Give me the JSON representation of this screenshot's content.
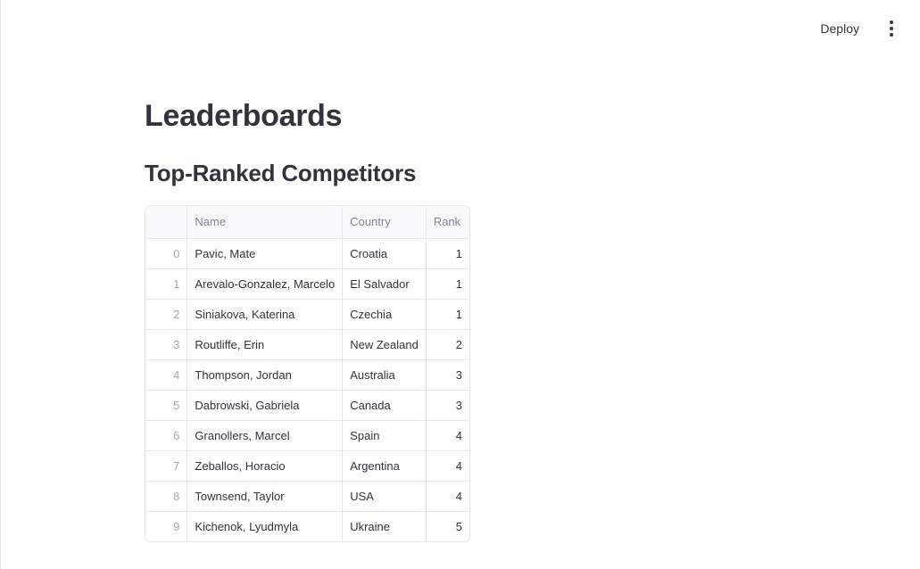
{
  "header": {
    "deploy_label": "Deploy"
  },
  "main": {
    "title": "Leaderboards",
    "subtitle": "Top-Ranked Competitors"
  },
  "table": {
    "columns": [
      "",
      "Name",
      "Country",
      "Rank"
    ],
    "rows": [
      {
        "index": "0",
        "name": "Pavic, Mate",
        "country": "Croatia",
        "rank": "1"
      },
      {
        "index": "1",
        "name": "Arevalo-Gonzalez, Marcelo",
        "country": "El Salvador",
        "rank": "1"
      },
      {
        "index": "2",
        "name": "Siniakova, Katerina",
        "country": "Czechia",
        "rank": "1"
      },
      {
        "index": "3",
        "name": "Routliffe, Erin",
        "country": "New Zealand",
        "rank": "2"
      },
      {
        "index": "4",
        "name": "Thompson, Jordan",
        "country": "Australia",
        "rank": "3"
      },
      {
        "index": "5",
        "name": "Dabrowski, Gabriela",
        "country": "Canada",
        "rank": "3"
      },
      {
        "index": "6",
        "name": "Granollers, Marcel",
        "country": "Spain",
        "rank": "4"
      },
      {
        "index": "7",
        "name": "Zeballos, Horacio",
        "country": "Argentina",
        "rank": "4"
      },
      {
        "index": "8",
        "name": "Townsend, Taylor",
        "country": "USA",
        "rank": "4"
      },
      {
        "index": "9",
        "name": "Kichenok, Lyudmyla",
        "country": "Ukraine",
        "rank": "5"
      }
    ]
  }
}
